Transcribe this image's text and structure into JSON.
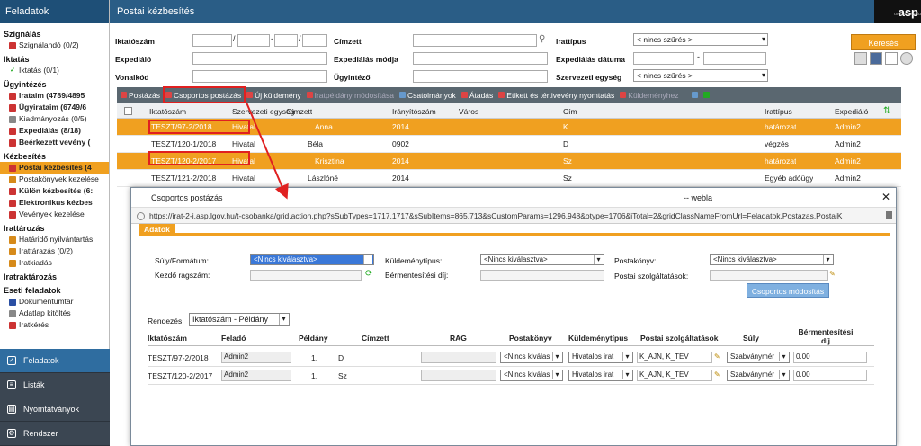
{
  "sidebar": {
    "title": "Feladatok",
    "sections": [
      {
        "label": "Szignálás",
        "items": [
          {
            "label": "Szignálandó (0/2)",
            "icon": "red-check-icon",
            "bold": false
          }
        ]
      },
      {
        "label": "Iktatás",
        "items": [
          {
            "label": "Iktatás (0/1)",
            "icon": "green-check-icon",
            "bold": false
          }
        ]
      },
      {
        "label": "Ügyintézés",
        "items": [
          {
            "label": "Irataim (4789/4895",
            "icon": "document-icon",
            "bold": true
          },
          {
            "label": "Ügyirataim (6749/6",
            "icon": "document-icon",
            "bold": true
          },
          {
            "label": "Kiadmányozás (0/5)",
            "icon": "sign-icon",
            "bold": false
          },
          {
            "label": "Expediálás (8/18)",
            "icon": "send-icon",
            "bold": true
          },
          {
            "label": "Beérkezett vevény (",
            "icon": "receipt-icon",
            "bold": true
          }
        ]
      },
      {
        "label": "Kézbesítés",
        "items": [
          {
            "label": "Postai kézbesítés (4",
            "icon": "mail-icon",
            "bold": true,
            "active": true
          },
          {
            "label": "Postakönyvek kezelése",
            "icon": "book-icon",
            "bold": false
          },
          {
            "label": "Külön kézbesítés (6:",
            "icon": "mail-icon",
            "bold": true
          },
          {
            "label": "Elektronikus kézbes",
            "icon": "mail-icon",
            "bold": true
          },
          {
            "label": "Vevények kezelése",
            "icon": "receipt-icon",
            "bold": false
          }
        ]
      },
      {
        "label": "Irattározás",
        "items": [
          {
            "label": "Határidő nyilvántartás",
            "icon": "calendar-icon",
            "bold": false
          },
          {
            "label": "Irattárazás (0/2)",
            "icon": "archive-icon",
            "bold": false
          },
          {
            "label": "Iratkiadás",
            "icon": "archive-icon",
            "bold": false
          }
        ]
      },
      {
        "label": "Iratraktározás",
        "items": []
      },
      {
        "label": "Eseti feladatok",
        "items": [
          {
            "label": "Dokumentumtár",
            "icon": "word-icon",
            "bold": false
          },
          {
            "label": "Adatlap kitöltés",
            "icon": "form-icon",
            "bold": false
          },
          {
            "label": "Iratkérés",
            "icon": "request-icon",
            "bold": false
          }
        ]
      }
    ],
    "bottom": [
      {
        "label": "Feladatok",
        "icon": "check-icon",
        "active": true
      },
      {
        "label": "Listák",
        "icon": "list-icon",
        "active": false
      },
      {
        "label": "Nyomtatványok",
        "icon": "print-icon",
        "active": false
      },
      {
        "label": "Rendszer",
        "icon": "settings-icon",
        "active": false
      }
    ]
  },
  "header": {
    "title": "Postai kézbesítés",
    "logo_small": "ÖNKORMÁNYZATI",
    "logo": "asp"
  },
  "filters": {
    "iktatoszam": "Iktatószám",
    "expedialo": "Expediáló",
    "vonalkod": "Vonalkód",
    "cimzett": "Címzett",
    "expedialas_modja": "Expediálás módja",
    "ugyintezo": "Ügyintéző",
    "irattipus": "Irattípus",
    "irattipus_value": "< nincs szűrés >",
    "expedialas_datuma": "Expediálás dátuma",
    "szervezeti_egyseg": "Szervezeti egység",
    "szervezeti_egyseg_value": "< nincs szűrés >",
    "search_button": "Keresés"
  },
  "toolbar": [
    {
      "label": "Postázás",
      "disabled": false
    },
    {
      "label": "Csoportos postázás",
      "disabled": false
    },
    {
      "label": "Új küldemény",
      "disabled": false
    },
    {
      "label": "Iratpéldány módosítása",
      "disabled": true
    },
    {
      "label": "Csatolmányok",
      "disabled": false
    },
    {
      "label": "Átadás",
      "disabled": false
    },
    {
      "label": "Etikett és tértivevény nyomtatás",
      "disabled": false
    },
    {
      "label": "Küldeményhez",
      "disabled": true
    }
  ],
  "grid": {
    "columns": [
      "Iktatószám",
      "Szervezeti egység",
      "Címzett",
      "Irányítószám",
      "Város",
      "Cím",
      "Irattípus",
      "Expediáló"
    ],
    "rows": [
      {
        "iktatoszam": "TESZT/97-2/2018",
        "szerv": "Hivatal",
        "cimzett": "Anna",
        "irsz": "2014",
        "varos": "",
        "cim": "K",
        "irattipus": "határozat",
        "expedialo": "Admin2",
        "selected": true
      },
      {
        "iktatoszam": "TESZT/120-1/2018",
        "szerv": "Hivatal",
        "cimzett": "Béla",
        "irsz": "0902",
        "varos": "",
        "cim": "D",
        "irattipus": "végzés",
        "expedialo": "Admin2",
        "selected": false
      },
      {
        "iktatoszam": "TESZT/120-2/2017",
        "szerv": "Hivatal",
        "cimzett": "Krisztina",
        "irsz": "2014",
        "varos": "",
        "cim": "Sz",
        "irattipus": "határozat",
        "expedialo": "Admin2",
        "selected": true
      },
      {
        "iktatoszam": "TESZT/121-2/2018",
        "szerv": "Hivatal",
        "cimzett": "Lászlóné",
        "irsz": "2014",
        "varos": "",
        "cim": "Sz",
        "irattipus": "Egyéb adóügy",
        "expedialo": "Admin2",
        "selected": false
      }
    ]
  },
  "dialog": {
    "title": "Csoportos postázás",
    "window_tag": "-- webla",
    "url": "https://irat-2-i.asp.lgov.hu/t-csobanka/grid.action.php?sSubTypes=1717,1717&sSubItems=865,713&sCustomParams=1296,948&otype=1706&iTotal=2&gridClassNameFromUrl=Feladatok.Postazas.PostaiK",
    "tab": "Adatok",
    "suly_label": "Súly/Formátum:",
    "suly_value": "<Nincs kiválasztva>",
    "kezdo_label": "Kezdő ragszám:",
    "kuldemeny_label": "Küldeménytípus:",
    "kuldemeny_value": "<Nincs kiválasztva>",
    "bermentesitesi_label": "Bérmentesítési díj:",
    "postakonyv_label": "Postakönyv:",
    "postakonyv_value": "<Nincs kiválasztva>",
    "szolg_label": "Postai szolgáltatások:",
    "modify_button": "Csoportos módosítás",
    "rendezes_label": "Rendezés:",
    "rendezes_value": "Iktatószám - Példány",
    "columns": [
      "Iktatószám",
      "Feladó",
      "Példány",
      "Címzett",
      "RAG",
      "Postakönyv",
      "Küldeménytípus",
      "Postai szolgáltatások",
      "Súly",
      "Bérmentesítési díj"
    ],
    "rows": [
      {
        "iktatoszam": "TESZT/97-2/2018",
        "felado": "Admin2",
        "peldany": "1.",
        "cimzett": "D",
        "postakonyv": "<Nincs kiválas",
        "kuldemeny": "Hivatalos irat",
        "szolg": "K_AJN, K_TEV",
        "suly": "Szabványmér",
        "dij": "0.00"
      },
      {
        "iktatoszam": "TESZT/120-2/2017",
        "felado": "Admin2",
        "peldany": "1.",
        "cimzett": "Sz",
        "postakonyv": "<Nincs kiválas",
        "kuldemeny": "Hivatalos irat",
        "szolg": "K_AJN, K_TEV",
        "suly": "Szabványmér",
        "dij": "0.00"
      }
    ]
  },
  "colors": {
    "accent": "#f0a020",
    "header": "#2a5d86",
    "highlight": "#e02020"
  }
}
